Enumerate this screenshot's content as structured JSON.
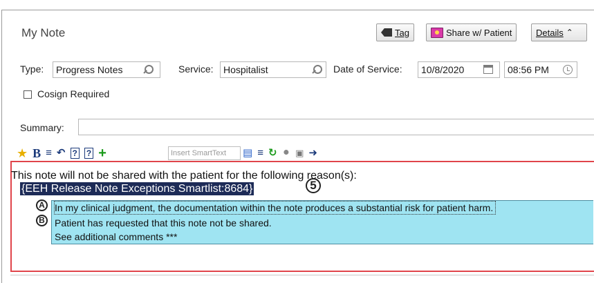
{
  "header_fragment": "",
  "note": {
    "title": "My Note",
    "tag_label": "Tag",
    "share_label": "Share w/ Patient",
    "details_label": "Details",
    "details_chevron": "≈"
  },
  "fields": {
    "type_label": "Type:",
    "type_value": "Progress Notes",
    "service_label": "Service:",
    "service_value": "Hospitalist",
    "date_label": "Date of Service:",
    "date_value": "10/8/2020",
    "time_value": "08:56 PM",
    "cosign_label": "Cosign Required",
    "cosign_checked": false,
    "summary_label": "Summary:",
    "summary_value": ""
  },
  "toolbar": {
    "bold": "B",
    "smarttext_placeholder": "Insert SmartText"
  },
  "editor": {
    "reason_line": "This note will not be shared with the patient for the following reason(s):",
    "smartlist": "{EEH Release Note Exceptions Smartlist:8684}",
    "options": [
      "In my clinical judgment, the documentation within the note produces a substantial risk for patient harm.",
      "Patient has requested that this note not be shared.",
      "See additional comments ***"
    ]
  },
  "callouts": {
    "smartlist_badge": "5",
    "option_a_badge": "A",
    "option_b_badge": "B"
  },
  "colors": {
    "editor_border": "#e0444a",
    "smartlist_bg": "#1d2b57",
    "options_bg": "#9fe4f2",
    "share_icon": "#d93aa8"
  }
}
